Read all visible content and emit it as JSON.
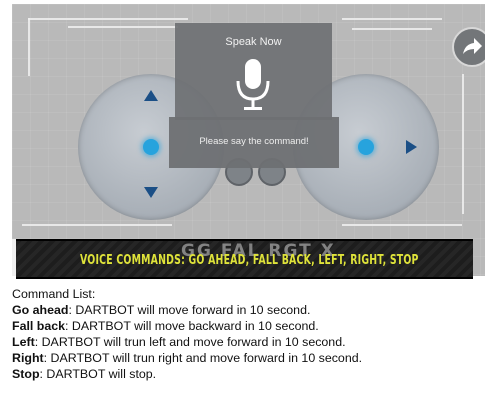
{
  "dialog": {
    "title": "Speak Now",
    "prompt": "Please say the command!"
  },
  "banner": {
    "ghost_text": "GG FAL RGT X",
    "text": "VOICE COMMANDS: GO AHEAD, FALL BACK, LEFT, RIGHT, STOP"
  },
  "command_list": {
    "heading": "Command List:",
    "items": [
      {
        "name": "Go ahead",
        "desc": ": DARTBOT will move forward in 10 second."
      },
      {
        "name": "Fall back",
        "desc": ": DARTBOT will move backward in 10 second."
      },
      {
        "name": "Left",
        "desc": ": DARTBOT will trun left and move forward in 10 second."
      },
      {
        "name": "Right",
        "desc": ": DARTBOT will trun right and move forward in 10 second."
      },
      {
        "name": "Stop",
        "desc": ": DARTBOT will stop."
      }
    ]
  },
  "colors": {
    "accent_blue": "#27a3dd",
    "arrow_navy": "#1b4f86",
    "banner_yellow": "#dfe33a"
  },
  "icons": {
    "microphone": "microphone-icon",
    "share": "share-arrow-icon"
  }
}
